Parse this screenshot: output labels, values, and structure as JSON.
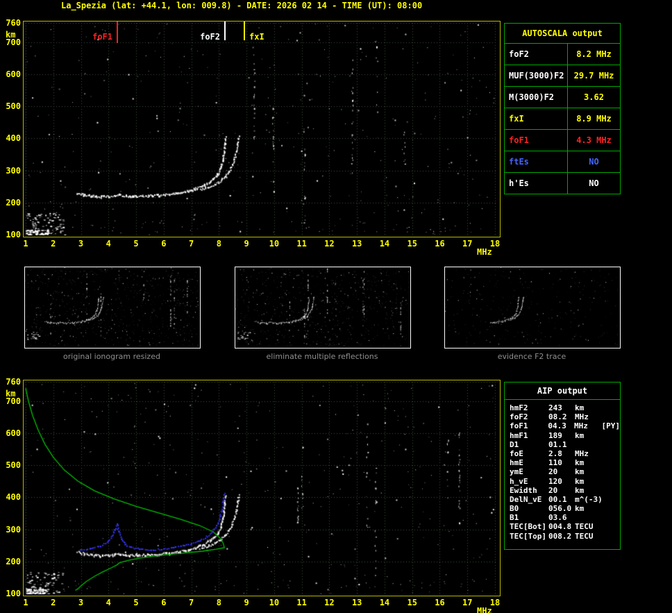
{
  "title": "La_Spezia (lat: +44.1, lon: 009.8) - DATE: 2026 02 14 - TIME (UT): 08:00",
  "axis": {
    "x_unit": "MHz",
    "y_unit": "km"
  },
  "colors": {
    "background": "#000000",
    "tick": "#ffff00",
    "plot_border": "#b8b800",
    "grid": "#3c503c",
    "trace_white": "#ffffff",
    "profile_green": "#00c000",
    "restored_blue": "#3a3aff",
    "table_border": "#00aa00",
    "value_yellow": "#ffff00",
    "alert_red": "#ff2222",
    "info_blue": "#4466ff",
    "text_white": "#ffffff",
    "caption_gray": "#8f8f8f"
  },
  "autoscala_table": {
    "title": "AUTOSCALA output",
    "rows": [
      {
        "label": "foF2",
        "value": "8.2 MHz",
        "label_color": "#ffffff",
        "value_color": "#ffff00"
      },
      {
        "label": "MUF(3000)F2",
        "value": "29.7 MHz",
        "label_color": "#ffffff",
        "value_color": "#ffff00"
      },
      {
        "label": "M(3000)F2",
        "value": "3.62",
        "label_color": "#ffffff",
        "value_color": "#ffff00"
      },
      {
        "label": "fxI",
        "value": "8.9 MHz",
        "label_color": "#ffff00",
        "value_color": "#ffff00"
      },
      {
        "label": "foF1",
        "value": "4.3 MHz",
        "label_color": "#ff2222",
        "value_color": "#ff2222"
      },
      {
        "label": "ftEs",
        "value": "NO",
        "label_color": "#4466ff",
        "value_color": "#4466ff"
      },
      {
        "label": "h'Es",
        "value": "NO",
        "label_color": "#ffffff",
        "value_color": "#ffffff"
      }
    ]
  },
  "aip_table": {
    "title": "AIP output",
    "rows": [
      {
        "name": "hmF2",
        "value": "243",
        "unit": "km",
        "extra": ""
      },
      {
        "name": "foF2",
        "value": "08.2",
        "unit": "MHz",
        "extra": ""
      },
      {
        "name": "foF1",
        "value": "04.3",
        "unit": "MHz",
        "extra": "[PY]"
      },
      {
        "name": "hmF1",
        "value": "189",
        "unit": "km",
        "extra": ""
      },
      {
        "name": "D1",
        "value": "01.1",
        "unit": "",
        "extra": ""
      },
      {
        "name": "foE",
        "value": "2.8",
        "unit": "MHz",
        "extra": ""
      },
      {
        "name": "hmE",
        "value": "110",
        "unit": "km",
        "extra": ""
      },
      {
        "name": "ymE",
        "value": "20",
        "unit": "km",
        "extra": ""
      },
      {
        "name": "h_vE",
        "value": "120",
        "unit": "km",
        "extra": ""
      },
      {
        "name": "Ewidth",
        "value": "20",
        "unit": "km",
        "extra": ""
      },
      {
        "name": "DelN_vE",
        "value": "00.1",
        "unit": "m^(-3)",
        "extra": ""
      },
      {
        "name": "B0",
        "value": "056.0",
        "unit": "km",
        "extra": ""
      },
      {
        "name": "B1",
        "value": "03.6",
        "unit": "",
        "extra": ""
      },
      {
        "name": "TEC[Bot]",
        "value": "004.8",
        "unit": "TECU",
        "extra": ""
      },
      {
        "name": "TEC[Top]",
        "value": "008.2",
        "unit": "TECU",
        "extra": ""
      }
    ]
  },
  "thumbnails": [
    {
      "caption": "original ionogram resized"
    },
    {
      "caption": "eliminate multiple reflections"
    },
    {
      "caption": "evidence F2 trace"
    }
  ],
  "chart_data": [
    {
      "type": "scatter",
      "title": "scaled ionogram with AUTOSCALA markers",
      "xlabel": "MHz",
      "ylabel": "km",
      "xlim": [
        1,
        18
      ],
      "ylim": [
        100,
        760
      ],
      "grid": true,
      "xticks": [
        1,
        2,
        3,
        4,
        5,
        6,
        7,
        8,
        9,
        10,
        11,
        12,
        13,
        14,
        15,
        16,
        17,
        18
      ],
      "yticks": [
        100,
        200,
        300,
        400,
        500,
        600,
        700,
        760
      ],
      "markers": [
        {
          "name": "foF1",
          "mhz": 4.3,
          "color": "#ff2222",
          "label_side": "left",
          "tick_height": 31
        },
        {
          "name": "foF2",
          "mhz": 8.2,
          "color": "#ffffff",
          "label_side": "left",
          "tick_height": 27
        },
        {
          "name": "fxI",
          "mhz": 8.9,
          "color": "#ffff00",
          "label_side": "right",
          "tick_height": 27
        }
      ],
      "o_trace": [
        [
          2.85,
          232
        ],
        [
          3.1,
          226
        ],
        [
          3.4,
          222
        ],
        [
          3.7,
          220
        ],
        [
          4.0,
          220
        ],
        [
          4.2,
          223
        ],
        [
          4.35,
          226
        ],
        [
          4.6,
          222
        ],
        [
          5.0,
          221
        ],
        [
          5.4,
          222
        ],
        [
          5.8,
          225
        ],
        [
          6.2,
          228
        ],
        [
          6.6,
          233
        ],
        [
          6.9,
          239
        ],
        [
          7.2,
          247
        ],
        [
          7.45,
          256
        ],
        [
          7.65,
          266
        ],
        [
          7.8,
          277
        ],
        [
          7.95,
          292
        ],
        [
          8.05,
          310
        ],
        [
          8.12,
          332
        ],
        [
          8.17,
          358
        ],
        [
          8.2,
          385
        ],
        [
          8.22,
          405
        ]
      ],
      "x_trace": [
        [
          7.3,
          243
        ],
        [
          7.6,
          250
        ],
        [
          7.85,
          259
        ],
        [
          8.05,
          270
        ],
        [
          8.2,
          283
        ],
        [
          8.35,
          298
        ],
        [
          8.45,
          315
        ],
        [
          8.55,
          338
        ],
        [
          8.62,
          362
        ],
        [
          8.67,
          388
        ],
        [
          8.7,
          408
        ]
      ],
      "e_region": {
        "f_range": [
          1.0,
          2.4
        ],
        "h_range": [
          100,
          168
        ]
      }
    },
    {
      "type": "scatter",
      "title": "ionogram with AIP electron density profile and restored trace",
      "xlabel": "MHz",
      "ylabel": "km",
      "xlim": [
        1,
        18
      ],
      "ylim": [
        100,
        760
      ],
      "grid": true,
      "xticks": [
        1,
        2,
        3,
        4,
        5,
        6,
        7,
        8,
        9,
        10,
        11,
        12,
        13,
        14,
        15,
        16,
        17,
        18
      ],
      "yticks": [
        100,
        200,
        300,
        400,
        500,
        600,
        700,
        760
      ],
      "o_trace": [
        [
          2.85,
          232
        ],
        [
          3.1,
          226
        ],
        [
          3.4,
          222
        ],
        [
          3.7,
          220
        ],
        [
          4.0,
          220
        ],
        [
          4.2,
          223
        ],
        [
          4.35,
          226
        ],
        [
          4.6,
          222
        ],
        [
          5.0,
          221
        ],
        [
          5.4,
          222
        ],
        [
          5.8,
          225
        ],
        [
          6.2,
          228
        ],
        [
          6.6,
          233
        ],
        [
          6.9,
          239
        ],
        [
          7.2,
          247
        ],
        [
          7.45,
          256
        ],
        [
          7.65,
          266
        ],
        [
          7.8,
          277
        ],
        [
          7.95,
          292
        ],
        [
          8.05,
          310
        ],
        [
          8.12,
          332
        ],
        [
          8.17,
          358
        ],
        [
          8.2,
          385
        ],
        [
          8.22,
          405
        ]
      ],
      "x_trace": [
        [
          7.3,
          243
        ],
        [
          7.6,
          250
        ],
        [
          7.85,
          259
        ],
        [
          8.05,
          270
        ],
        [
          8.2,
          283
        ],
        [
          8.35,
          298
        ],
        [
          8.45,
          315
        ],
        [
          8.55,
          338
        ],
        [
          8.62,
          362
        ],
        [
          8.67,
          388
        ],
        [
          8.7,
          408
        ]
      ],
      "restored_trace": [
        [
          2.95,
          238
        ],
        [
          3.3,
          242
        ],
        [
          3.7,
          250
        ],
        [
          3.95,
          262
        ],
        [
          4.1,
          280
        ],
        [
          4.2,
          300
        ],
        [
          4.28,
          318
        ],
        [
          4.35,
          295
        ],
        [
          4.45,
          272
        ],
        [
          4.6,
          255
        ],
        [
          4.8,
          246
        ],
        [
          5.1,
          240
        ],
        [
          5.5,
          238
        ],
        [
          5.9,
          240
        ],
        [
          6.3,
          244
        ],
        [
          6.7,
          250
        ],
        [
          7.0,
          257
        ],
        [
          7.3,
          267
        ],
        [
          7.55,
          279
        ],
        [
          7.75,
          294
        ],
        [
          7.9,
          312
        ],
        [
          8.0,
          334
        ],
        [
          8.08,
          360
        ],
        [
          8.14,
          390
        ],
        [
          8.18,
          415
        ]
      ],
      "profile_topside": [
        [
          1.0,
          740
        ],
        [
          1.1,
          700
        ],
        [
          1.25,
          655
        ],
        [
          1.45,
          610
        ],
        [
          1.7,
          565
        ],
        [
          2.0,
          525
        ],
        [
          2.4,
          485
        ],
        [
          2.9,
          450
        ],
        [
          3.5,
          420
        ],
        [
          4.2,
          395
        ],
        [
          5.0,
          372
        ],
        [
          5.8,
          352
        ],
        [
          6.6,
          332
        ],
        [
          7.3,
          312
        ],
        [
          7.8,
          292
        ],
        [
          8.05,
          272
        ],
        [
          8.15,
          258
        ],
        [
          8.2,
          243
        ]
      ],
      "profile_bottomside": [
        [
          8.2,
          243
        ],
        [
          7.9,
          238
        ],
        [
          7.4,
          232
        ],
        [
          6.8,
          227
        ],
        [
          6.2,
          222
        ],
        [
          5.6,
          216
        ],
        [
          5.1,
          210
        ],
        [
          4.7,
          203
        ],
        [
          4.4,
          196
        ],
        [
          4.3,
          189
        ],
        [
          4.1,
          180
        ],
        [
          3.8,
          168
        ],
        [
          3.5,
          154
        ],
        [
          3.2,
          138
        ],
        [
          3.0,
          124
        ],
        [
          2.9,
          115
        ],
        [
          2.8,
          110
        ]
      ],
      "e_region": {
        "f_range": [
          1.0,
          2.4
        ],
        "h_range": [
          100,
          168
        ]
      }
    }
  ]
}
